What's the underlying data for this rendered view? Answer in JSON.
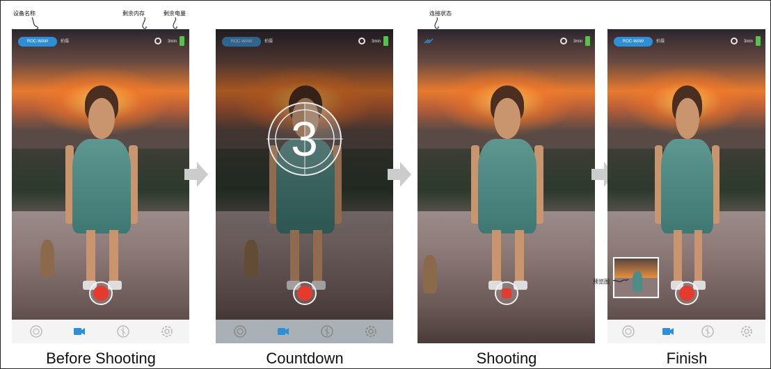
{
  "annotations": {
    "device_name": "设备名称",
    "remaining_memory": "剩余内存",
    "remaining_battery": "剩余电量",
    "connection_status": "连接状态",
    "preview_image": "预览图"
  },
  "app": {
    "device_label": "ROC-WAW",
    "mode_label": "拍摄",
    "memory_text": "3min",
    "countdown_number": "3"
  },
  "tabs": [
    {
      "icon": "gallery-icon"
    },
    {
      "icon": "video-camera-icon"
    },
    {
      "icon": "effects-icon"
    },
    {
      "icon": "settings-icon"
    }
  ],
  "steps": [
    {
      "caption": "Before Shooting"
    },
    {
      "caption": "Countdown"
    },
    {
      "caption": "Shooting"
    },
    {
      "caption": "Finish"
    }
  ],
  "colors": {
    "accent_blue": "#2e8fd6",
    "record_red": "#e53a2e",
    "battery_green": "#55c24a",
    "arrow_gray": "#cccccc"
  }
}
